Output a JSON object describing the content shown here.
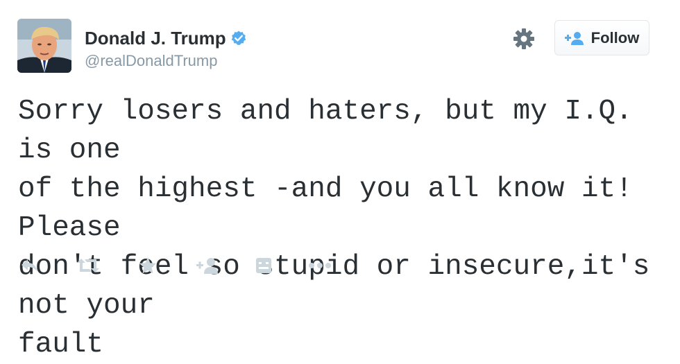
{
  "tweet": {
    "author": {
      "display_name": "Donald J. Trump",
      "handle": "@realDonaldTrump",
      "verified": true
    },
    "text": "Sorry losers and haters, but my I.Q. is one\nof the highest -and you all know it! Please\ndon't feel so stupid or insecure,it's not your\nfault",
    "follow_button": {
      "label": "Follow",
      "icon": "add-user-icon"
    },
    "settings_icon": "gear-icon",
    "actions": [
      {
        "icon": "reply-icon"
      },
      {
        "icon": "retweet-icon"
      },
      {
        "icon": "favorite-star-icon"
      },
      {
        "icon": "add-user-icon"
      },
      {
        "icon": "media-icon"
      },
      {
        "icon": "more-dots-icon"
      }
    ]
  },
  "colors": {
    "text": "#292f33",
    "muted": "#8899a6",
    "verified_blue": "#55acee",
    "follow_icon_blue": "#55acee",
    "action_gray": "#ccd6dd"
  }
}
